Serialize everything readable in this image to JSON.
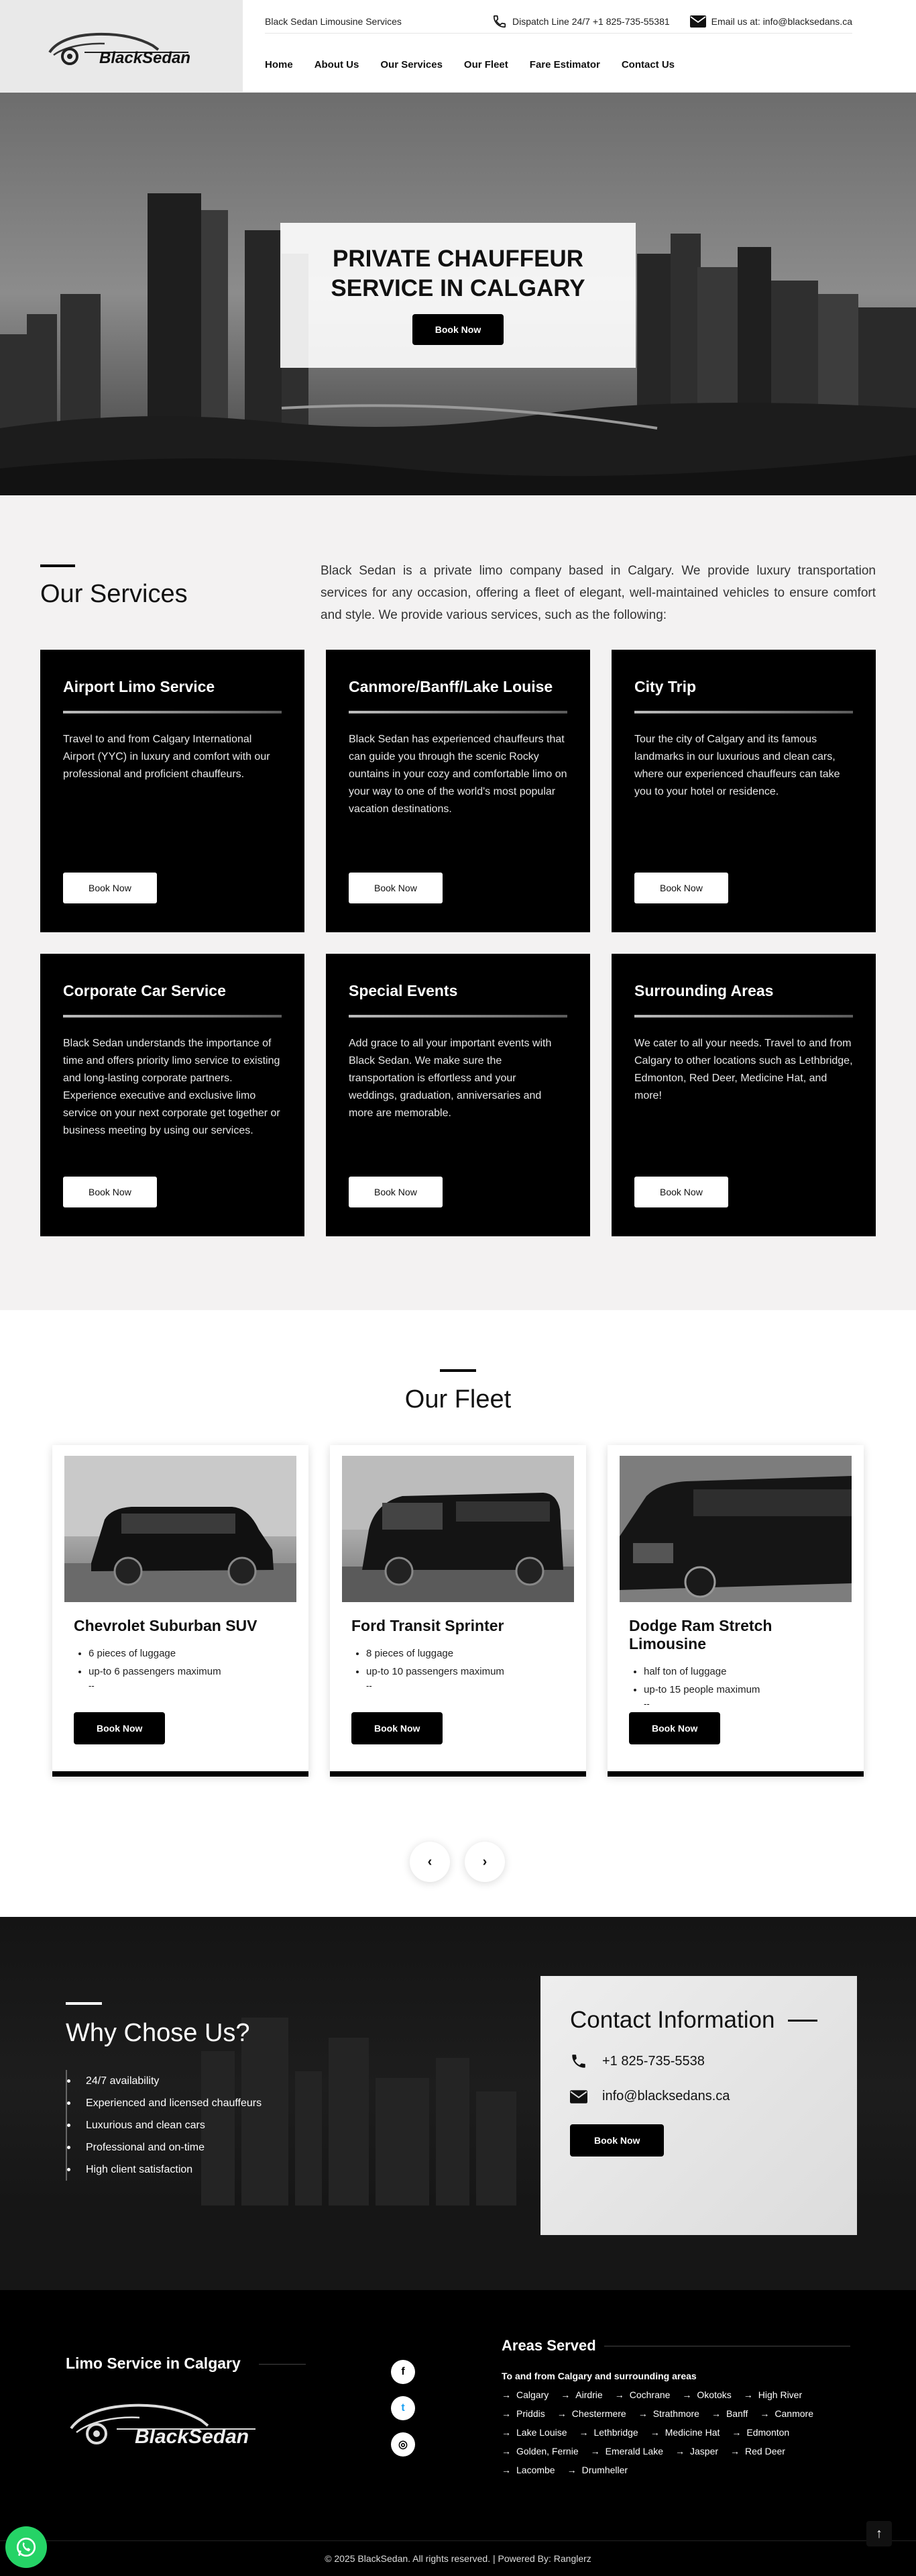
{
  "header": {
    "logo_text": "BlackSedan",
    "brand": "Black Sedan Limousine Services",
    "dispatch": "Dispatch Line 24/7 +1 825-735-55381",
    "email": "Email us at: info@blacksedans.ca",
    "nav": [
      "Home",
      "About Us",
      "Our Services",
      "Our Fleet",
      "Fare Estimator",
      "Contact Us"
    ]
  },
  "hero": {
    "title_line1": "PRIVATE CHAUFFEUR",
    "title_line2": "SERVICE IN CALGARY",
    "button": "Book Now"
  },
  "services": {
    "title": "Our Services",
    "intro": "Black Sedan is a private limo company based in Calgary. We provide luxury transportation services for any occasion, offering a fleet of elegant, well-maintained vehicles to ensure comfort and style. We provide various services, such as the following:",
    "cards": [
      {
        "title": "Airport Limo Service",
        "text": "Travel to and from Calgary International Airport (YYC) in luxury and comfort with our professional and proficient chauffeurs.",
        "button": "Book Now"
      },
      {
        "title": "Canmore/Banff/Lake Louise",
        "text": "Black Sedan has experienced chauffeurs that can guide you through the scenic Rocky ountains in your cozy and comfortable limo on your way to one of the world's most popular vacation destinations.",
        "button": "Book Now"
      },
      {
        "title": "City Trip",
        "text": "Tour the city of Calgary and its famous landmarks in our luxurious and clean cars, where our experienced chauffeurs can take you to your hotel or residence.",
        "button": "Book Now"
      },
      {
        "title": "Corporate Car Service",
        "text": "Black Sedan understands the importance of time and offers priority limo service to existing and long-lasting corporate partners. Experience executive and exclusive limo service on your next corporate get together or business meeting by using our services.",
        "button": "Book Now"
      },
      {
        "title": "Special Events",
        "text": "Add grace to all your important events with Black Sedan. We make sure the transportation is effortless and your weddings, graduation, anniversaries and more are memorable.",
        "button": "Book Now"
      },
      {
        "title": "Surrounding Areas",
        "text": "We cater to all your needs. Travel to and from Calgary to other locations such as Lethbridge, Edmonton, Red Deer, Medicine Hat, and more!",
        "button": "Book Now"
      }
    ]
  },
  "fleet": {
    "title": "Our Fleet",
    "cars": [
      {
        "name": "Chevrolet Suburban SUV",
        "features": [
          "6 pieces of luggage",
          "up-to 6 passengers maximum"
        ],
        "dash": "--",
        "button": "Book Now"
      },
      {
        "name": "Ford Transit Sprinter",
        "features": [
          "8 pieces of luggage",
          "up-to 10 passengers maximum"
        ],
        "dash": "--",
        "button": "Book Now"
      },
      {
        "name": "Dodge Ram Stretch Limousine",
        "features": [
          "half ton of luggage",
          "up-to 15 people maximum"
        ],
        "dash": "--",
        "button": "Book Now"
      }
    ],
    "prev": "‹",
    "next": "›"
  },
  "why": {
    "title": "Why Chose Us?",
    "items": [
      "24/7 availability",
      "Experienced and licensed chauffeurs",
      "Luxurious and clean cars",
      "Professional and on-time",
      "High client satisfaction"
    ]
  },
  "contact": {
    "title": "Contact Information",
    "phone": "+1 825-735-5538",
    "email": "info@blacksedans.ca",
    "button": "Book Now"
  },
  "footer": {
    "title": "Limo Service in Calgary",
    "logo_text": "BlackSedan",
    "social": {
      "facebook": "f",
      "twitter": "t",
      "instagram": "◎"
    },
    "areas_title": "Areas Served",
    "areas_sub": "To and from Calgary and surrounding areas",
    "areas": [
      "Calgary",
      "Airdrie",
      "Cochrane",
      "Okotoks",
      "High River",
      "Priddis",
      "Chestermere",
      "Strathmore",
      "Banff",
      "Canmore",
      "Lake Louise",
      "Lethbridge",
      "Medicine Hat",
      "Edmonton",
      "Golden, Fernie",
      "Emerald Lake",
      "Jasper",
      "Red Deer",
      "Lacombe",
      "Drumheller"
    ],
    "copyright": "© 2025 BlackSedan. All rights reserved. | Powered By: Ranglerz",
    "to_top": "↑"
  },
  "colors": {
    "accent": "#000000",
    "whatsapp": "#25d366",
    "service_bg": "#f3f2f2"
  }
}
